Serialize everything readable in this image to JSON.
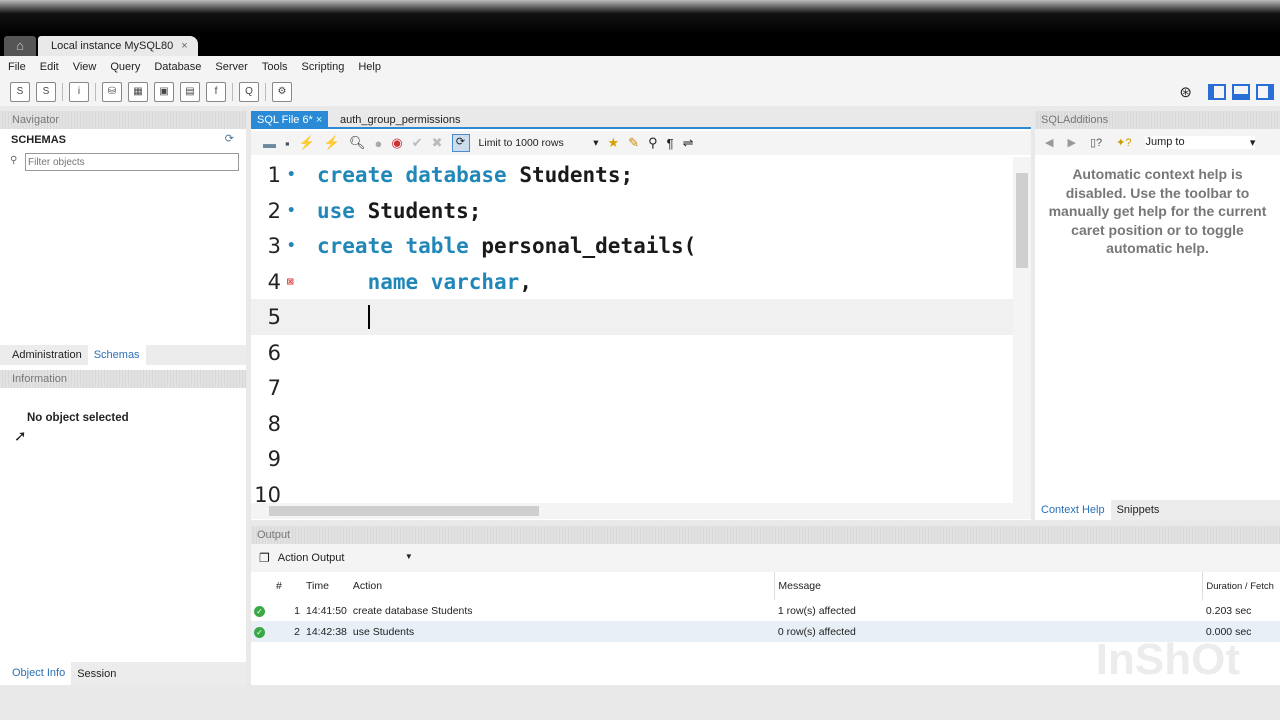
{
  "window": {
    "home_icon": "home-icon",
    "connection_tab": "Local instance MySQL80",
    "close": "×"
  },
  "menu": [
    "File",
    "Edit",
    "View",
    "Query",
    "Database",
    "Server",
    "Tools",
    "Scripting",
    "Help"
  ],
  "navigator": {
    "title": "Navigator",
    "schemas_label": "SCHEMAS",
    "filter_placeholder": "Filter objects",
    "tabs": [
      "Administration",
      "Schemas"
    ],
    "info_title": "Information",
    "no_object": "No object selected",
    "bottom_tabs": [
      "Object Info",
      "Session"
    ]
  },
  "editor": {
    "tabs": [
      {
        "label": "SQL File 6*",
        "close": "×",
        "active": true
      },
      {
        "label": "auth_group_permissions",
        "active": false
      }
    ],
    "limit": "Limit to 1000 rows",
    "lines": [
      {
        "n": "1",
        "tokens": [
          [
            "kw",
            "create "
          ],
          [
            "kw",
            "database "
          ],
          [
            "id",
            "Students;"
          ]
        ]
      },
      {
        "n": "2",
        "tokens": [
          [
            "kw",
            "use "
          ],
          [
            "id",
            "Students;"
          ]
        ]
      },
      {
        "n": "3",
        "tokens": [
          [
            "kw",
            "create "
          ],
          [
            "kw",
            "table "
          ],
          [
            "id",
            "personal_details("
          ]
        ]
      },
      {
        "n": "4",
        "tokens": [
          [
            "kw",
            "    name "
          ],
          [
            "kw",
            "varchar"
          ],
          [
            "id",
            ","
          ]
        ]
      },
      {
        "n": "5",
        "tokens": []
      },
      {
        "n": "6",
        "tokens": []
      },
      {
        "n": "7",
        "tokens": []
      },
      {
        "n": "8",
        "tokens": []
      },
      {
        "n": "9",
        "tokens": []
      },
      {
        "n": "10",
        "tokens": []
      }
    ]
  },
  "sqladditions": {
    "title": "SQLAdditions",
    "jump_to": "Jump to",
    "help_text": "Automatic context help is disabled. Use the toolbar to manually get help for the current caret position or to toggle automatic help.",
    "tabs": [
      "Context Help",
      "Snippets"
    ]
  },
  "output": {
    "title": "Output",
    "mode": "Action Output",
    "columns": [
      "#",
      "Time",
      "Action",
      "Message",
      "Duration / Fetch"
    ],
    "rows": [
      {
        "n": "1",
        "time": "14:41:50",
        "action": "create database Students",
        "message": "1 row(s) affected",
        "duration": "0.203 sec"
      },
      {
        "n": "2",
        "time": "14:42:38",
        "action": "use Students",
        "message": "0 row(s) affected",
        "duration": "0.000 sec"
      }
    ]
  },
  "watermark": "InShOt"
}
